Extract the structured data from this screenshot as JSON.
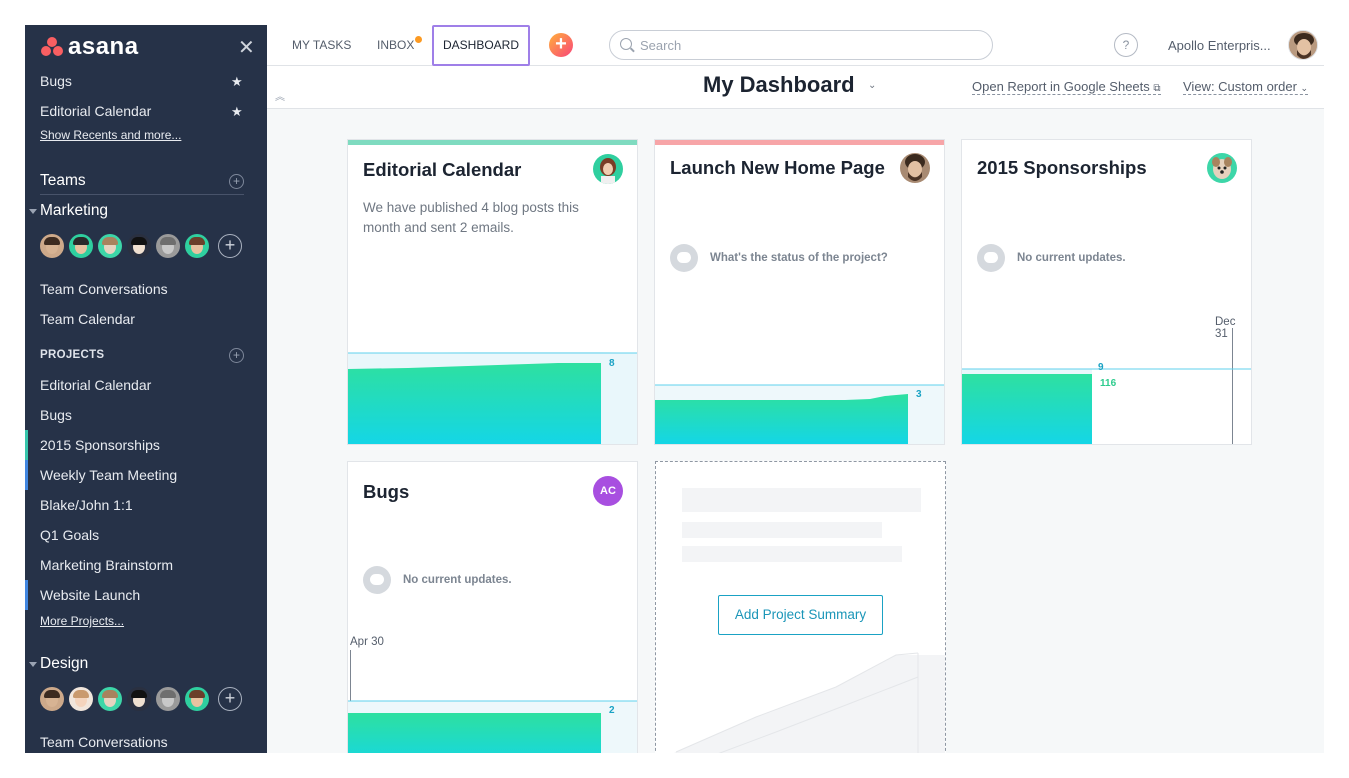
{
  "app": {
    "logo_text": "asana"
  },
  "sidebar": {
    "favorites": [
      {
        "label": "Bugs"
      },
      {
        "label": "Editorial Calendar"
      }
    ],
    "show_recents": "Show Recents and more...",
    "teams_header": "Teams",
    "marketing": {
      "name": "Marketing",
      "links": [
        "Team Conversations",
        "Team Calendar"
      ],
      "projects_header": "PROJECTS",
      "projects": [
        {
          "label": "Editorial Calendar",
          "color": ""
        },
        {
          "label": "Bugs",
          "color": ""
        },
        {
          "label": "2015 Sponsorships",
          "color": "#37c5ab"
        },
        {
          "label": "Weekly Team Meeting",
          "color": "#4186e0"
        },
        {
          "label": "Blake/John 1:1",
          "color": ""
        },
        {
          "label": "Q1 Goals",
          "color": ""
        },
        {
          "label": "Marketing Brainstorm",
          "color": ""
        },
        {
          "label": "Website Launch",
          "color": "#4186e0"
        }
      ],
      "more_projects": "More Projects..."
    },
    "design": {
      "name": "Design",
      "links": [
        "Team Conversations"
      ]
    }
  },
  "topbar": {
    "tabs": [
      {
        "label": "MY TASKS"
      },
      {
        "label": "INBOX"
      },
      {
        "label": "DASHBOARD"
      }
    ],
    "search_placeholder": "Search",
    "help_label": "?",
    "user_name": "Apollo Enterpris..."
  },
  "header": {
    "title": "My Dashboard",
    "open_report": "Open Report in Google Sheets",
    "view_label": "View: Custom order"
  },
  "cards": [
    {
      "title": "Editorial Calendar",
      "status_color": "#7fdbc0",
      "description": "We have published 4 blog posts this month and sent 2 emails.",
      "chart_label": "8"
    },
    {
      "title": "Launch New Home Page",
      "status_color": "#f7a5a8",
      "status_text": "What's the status of the project?",
      "chart_label": "3"
    },
    {
      "title": "2015 Sponsorships",
      "status_text": "No current updates.",
      "date_label": "Dec 31",
      "chart_label": "9",
      "chart_label_2": "116"
    },
    {
      "title": "Bugs",
      "avatar_initials": "AC",
      "status_text": "No current updates.",
      "date_label": "Apr 30",
      "chart_label": "2"
    }
  ],
  "add_summary": {
    "button_label": "Add Project Summary"
  },
  "colors": {
    "sidebar_bg": "#263248",
    "accent_teal": "#1aa2c4",
    "chart_green": "#2ee0a0",
    "chart_cyan": "#14d6e6"
  }
}
